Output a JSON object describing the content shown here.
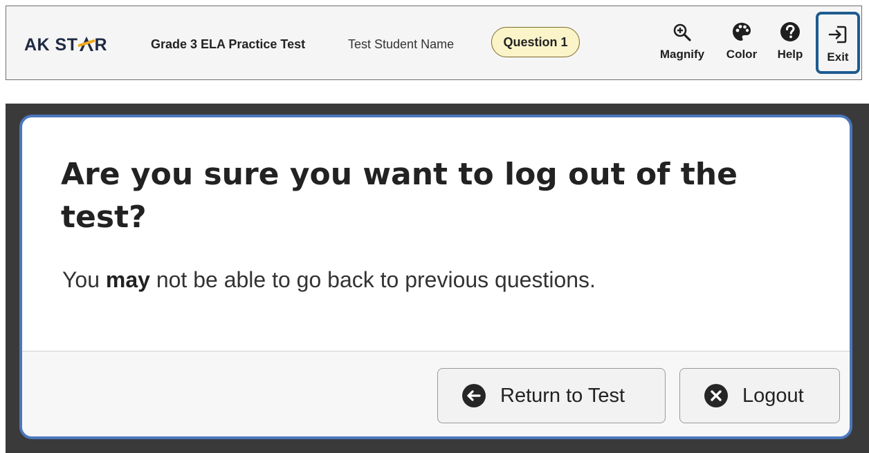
{
  "toolbar": {
    "logo_prefix": "AK ST",
    "logo_suffix": "R",
    "test_name": "Grade 3 ELA Practice Test",
    "student_name": "Test Student Name",
    "question_badge": "Question 1",
    "tools": {
      "magnify": {
        "label": "Magnify",
        "icon": "magnify-plus-icon"
      },
      "color": {
        "label": "Color",
        "icon": "palette-icon"
      },
      "help": {
        "label": "Help",
        "icon": "question-circle-icon"
      },
      "exit": {
        "label": "Exit",
        "icon": "exit-door-icon"
      }
    }
  },
  "dialog": {
    "title": "Are you sure you want to log out of the test?",
    "message_before": "You ",
    "message_bold": "may",
    "message_after": " not be able to go back to previous questions.",
    "buttons": {
      "return": {
        "label": "Return to Test",
        "icon": "arrow-left-circle-icon"
      },
      "logout": {
        "label": "Logout",
        "icon": "close-circle-icon"
      }
    }
  },
  "colors": {
    "logo": "#1f2a44",
    "logo_star": "#f2a81d",
    "badge_bg": "#fbf4c9",
    "exit_outline": "#1d5b8f",
    "dialog_border": "#4a77bd",
    "backdrop": "#3a3a3a"
  }
}
